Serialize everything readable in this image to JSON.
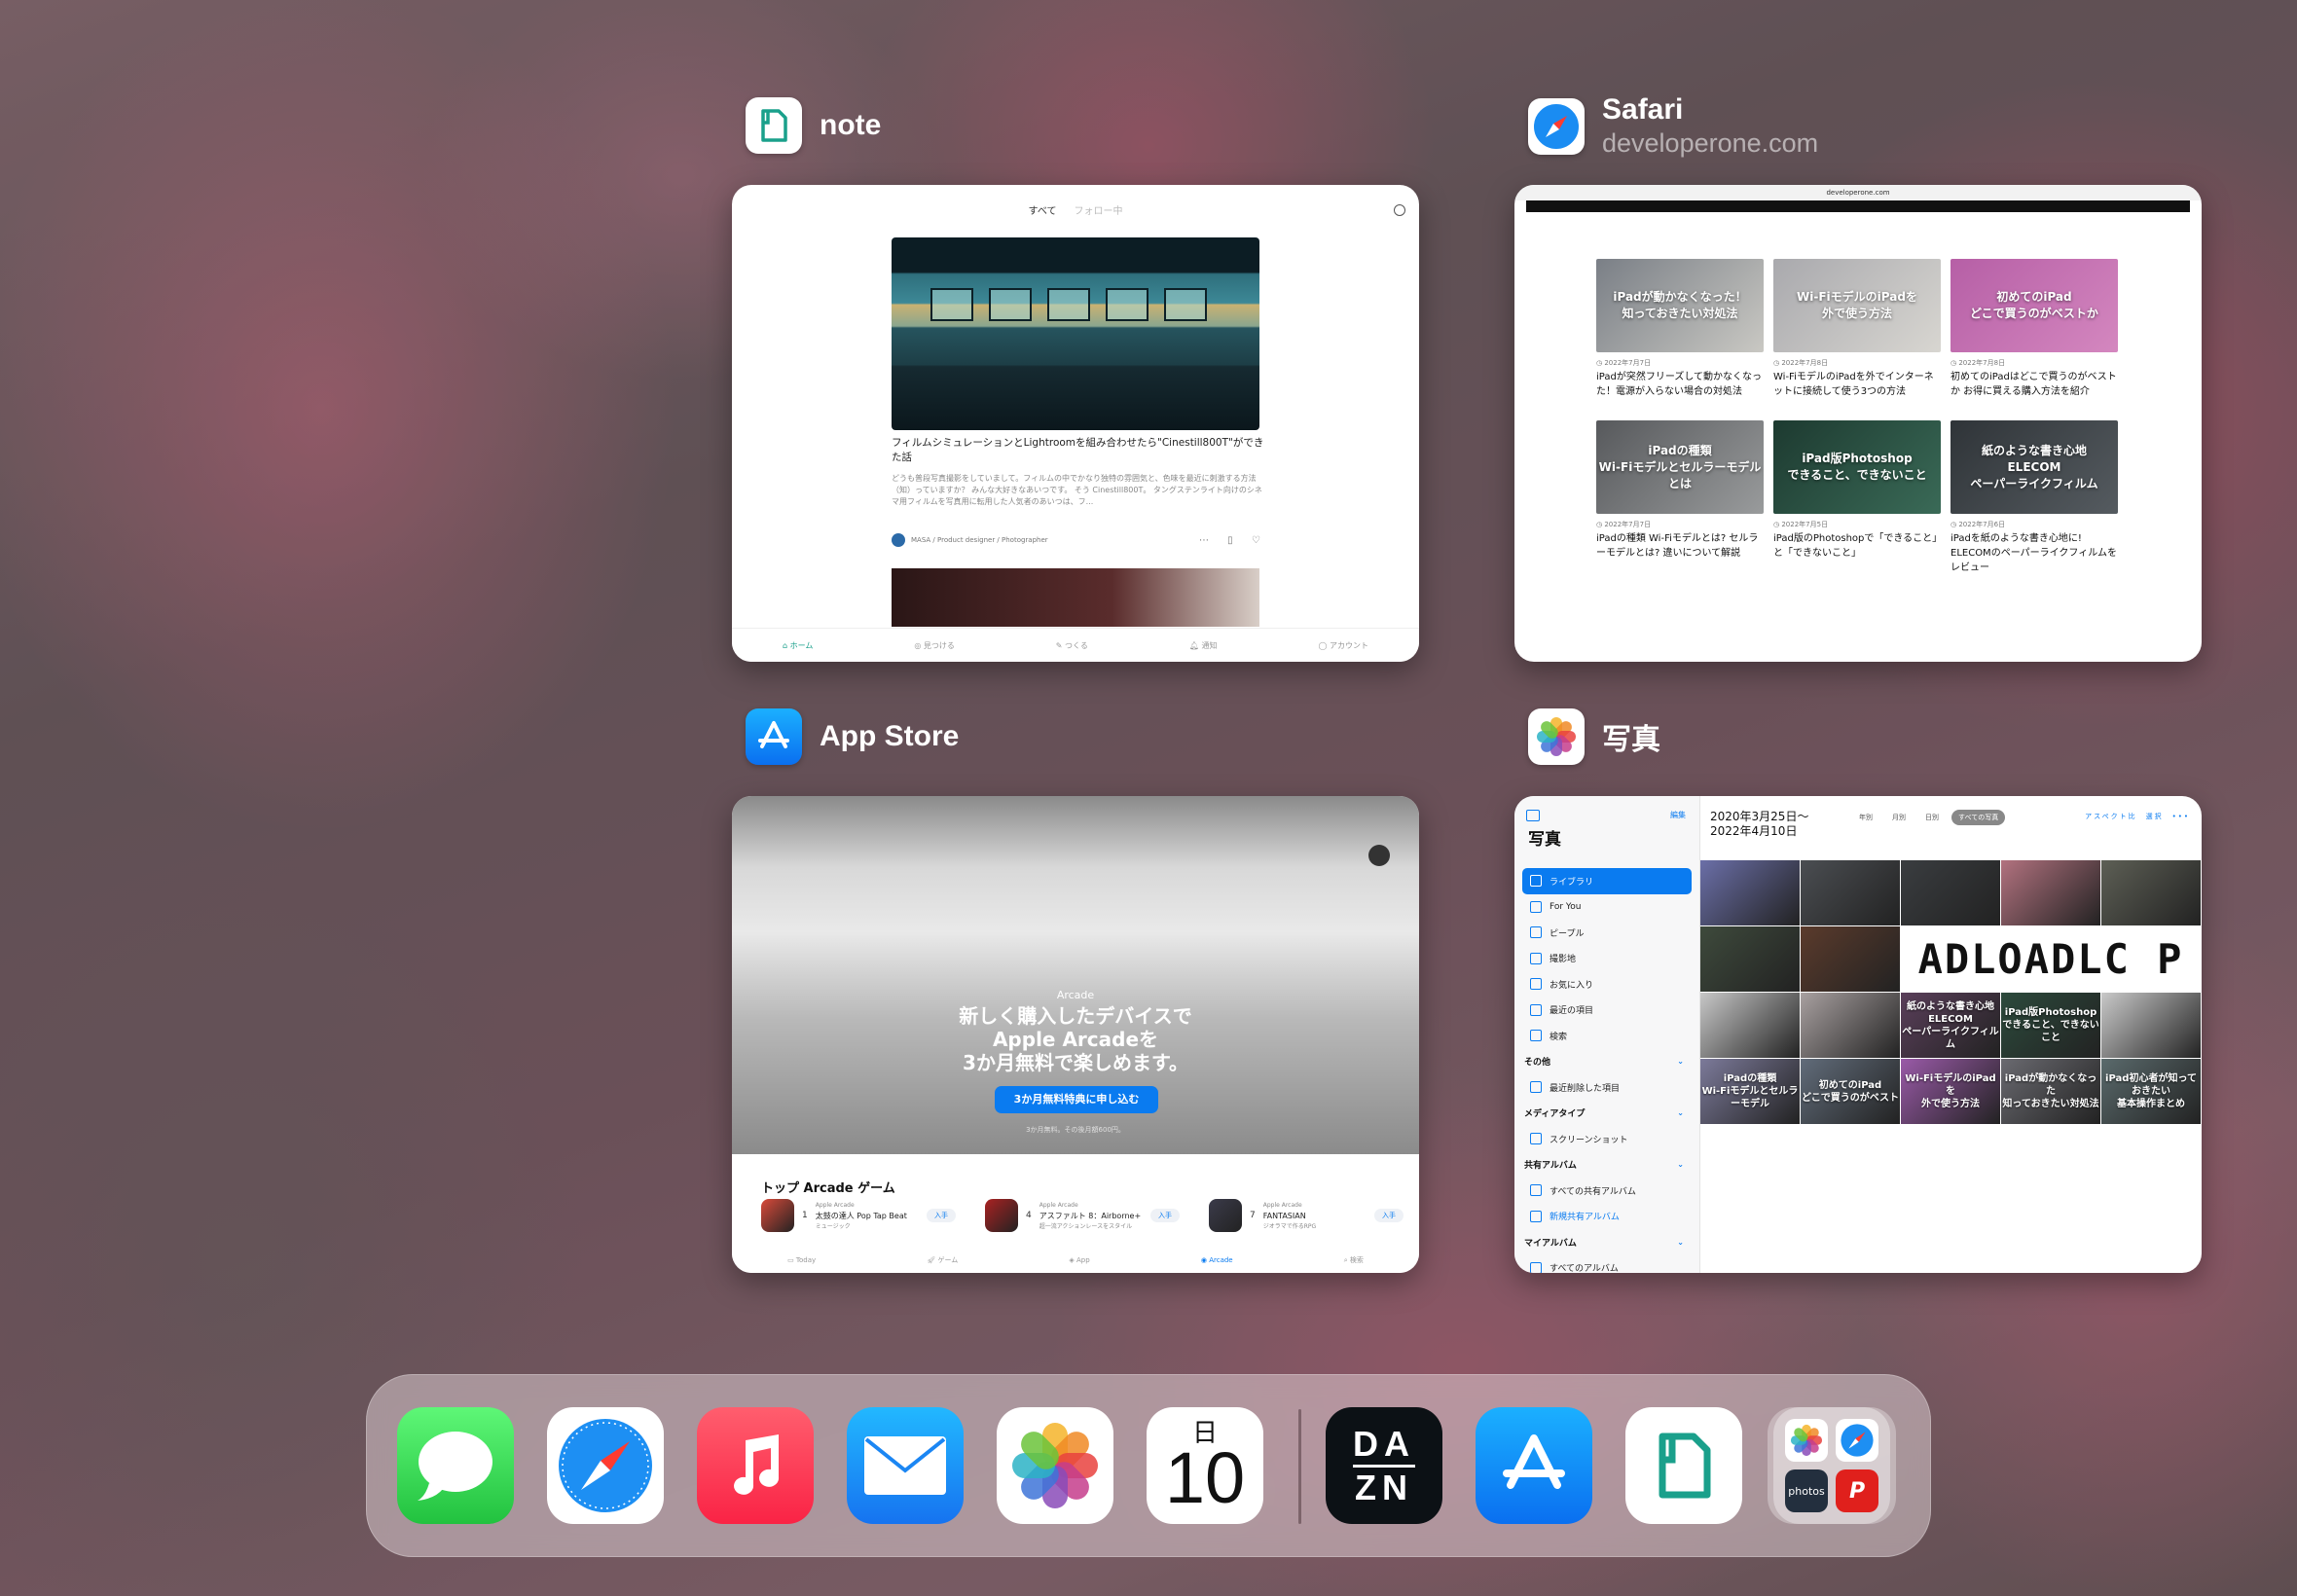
{
  "switcher": {
    "note": {
      "title": "note",
      "top_tabs": [
        "すべて",
        "フォロー中"
      ],
      "caption": "フィルムシミュレーションとLightroomを組み合わせたら\"Cinestill800T\"ができた話",
      "excerpt": "どうも普段写真撮影をしていまして。フィルムの中でかなり独特の雰囲気と、色味を最近に刺激する方法（知）っていますか？ みんな大好きなあいつです。 そう Cinestill800T。 タングステンライト向けのシネマ用フィルムを写真用に転用した人気者のあいつは、フ...",
      "author": "MASA / Product designer / Photographer",
      "tabbar": [
        "ホーム",
        "見つける",
        "つくる",
        "通知",
        "アカウント"
      ]
    },
    "safari": {
      "title": "Safari",
      "subtitle": "developerone.com",
      "url_bar": "developerone.com",
      "articles": [
        {
          "img_text": "iPadが動かなくなった！\n知っておきたい対処法",
          "date": "2022年7月7日",
          "title": "iPadが突然フリーズして動かなくなった！電源が入らない場合の対処法",
          "color1": "#7a7f86",
          "color2": "#c9c8c3"
        },
        {
          "img_text": "Wi-FiモデルのiPadを\n外で使う方法",
          "date": "2022年7月8日",
          "title": "Wi-FiモデルのiPadを外でインターネットに接続して使う3つの方法",
          "color1": "#a9a9ad",
          "color2": "#d8d6d1"
        },
        {
          "img_text": "初めてのiPad\nどこで買うのがベストか",
          "date": "2022年7月8日",
          "title": "初めてのiPadはどこで買うのがベストか お得に買える購入方法を紹介",
          "color1": "#b65fa6",
          "color2": "#d487bf"
        },
        {
          "img_text": "iPadの種類\nWi-Fiモデルとセルラーモデルとは",
          "date": "2022年7月7日",
          "title": "iPadの種類 Wi-Fiモデルとは? セルラーモデルとは? 違いについて解説",
          "color1": "#57595c",
          "color2": "#999b9c"
        },
        {
          "img_text": "iPad版Photoshop\nできること、できないこと",
          "date": "2022年7月5日",
          "title": "iPad版のPhotoshopで「できること」と「できないこと」",
          "color1": "#1d3a30",
          "color2": "#3a6a57"
        },
        {
          "img_text": "紙のような書き心地\nELECOM\nペーパーライクフィルム",
          "date": "2022年7月6日",
          "title": "iPadを紙のような書き心地に! ELECOMのペーパーライクフィルムをレビュー",
          "color1": "#2f3438",
          "color2": "#555b60"
        }
      ]
    },
    "appstore": {
      "title": "App Store",
      "arcade_label": "Arcade",
      "headline": "新しく購入したデバイスで\nApple Arcadeを\n3か月無料で楽しめます。",
      "button": "3か月無料特典に申し込む",
      "fine_print": "3か月無料。その後月額600円。",
      "section": "トップ Arcade ゲーム",
      "games": [
        {
          "rank": "1",
          "source": "Apple Arcade",
          "name": "太鼓の達人 Pop Tap Beat",
          "sub": "ミュージック",
          "get": "入手",
          "color": "#d94a3a"
        },
        {
          "rank": "4",
          "source": "Apple Arcade",
          "name": "アスファルト 8：Airborne+",
          "sub": "超一流アクションレースをスタイル",
          "get": "入手",
          "color": "#aa2222"
        },
        {
          "rank": "7",
          "source": "Apple Arcade",
          "name": "FANTASIAN",
          "sub": "ジオラマで作るRPG",
          "get": "入手",
          "color": "#3b3b4a"
        }
      ],
      "tabbar": [
        "Today",
        "ゲーム",
        "App",
        "Arcade",
        "検索"
      ]
    },
    "photos": {
      "title": "写真",
      "edit": "編集",
      "sidebar_title": "写真",
      "date_range": "2020年3月25日〜\n2022年4月10日",
      "segments": [
        "年別",
        "月別",
        "日別",
        "すべての写真"
      ],
      "tools": "アスペクト比　選択　•••",
      "sidebar": [
        {
          "label": "ライブラリ",
          "type": "item",
          "selected": true
        },
        {
          "label": "For You",
          "type": "item"
        },
        {
          "label": "ピープル",
          "type": "item"
        },
        {
          "label": "撮影地",
          "type": "item"
        },
        {
          "label": "お気に入り",
          "type": "item"
        },
        {
          "label": "最近の項目",
          "type": "item"
        },
        {
          "label": "検索",
          "type": "item"
        },
        {
          "label": "その他",
          "type": "section"
        },
        {
          "label": "最近削除した項目",
          "type": "item"
        },
        {
          "label": "メディアタイプ",
          "type": "section"
        },
        {
          "label": "スクリーンショット",
          "type": "item"
        },
        {
          "label": "共有アルバム",
          "type": "section"
        },
        {
          "label": "すべての共有アルバム",
          "type": "item"
        },
        {
          "label": "新規共有アルバム",
          "type": "item-blue"
        },
        {
          "label": "マイアルバム",
          "type": "section"
        },
        {
          "label": "すべてのアルバム",
          "type": "item"
        }
      ],
      "logo_text": "ADLOADLC P",
      "tile_texts": [
        {
          "index": 10,
          "text": "紙のような書き心地\nELECOM\nペーパーライクフィルム"
        },
        {
          "index": 11,
          "text": "iPad版Photoshop\nできること、できないこと"
        },
        {
          "index": 13,
          "text": "iPadの種類\nWi-Fiモデルとセルラーモデル"
        },
        {
          "index": 14,
          "text": "初めてのiPad\nどこで買うのがベスト"
        },
        {
          "index": 15,
          "text": "Wi-FiモデルのiPadを\n外で使う方法"
        },
        {
          "index": 16,
          "text": "iPadが動かなくなった\n知っておきたい対処法"
        },
        {
          "index": 17,
          "text": "iPad初心者が知っておきたい\n基本操作まとめ"
        }
      ]
    }
  },
  "dock": {
    "apps": [
      "Messages",
      "Safari",
      "Music",
      "Mail",
      "Photos",
      "Calendar",
      "DAZN",
      "App Store",
      "note",
      "Recent apps folder"
    ],
    "calendar_day": "日",
    "calendar_date": "10",
    "dazn_text": [
      "DA",
      "ZN"
    ],
    "folder_labels": [
      "photos",
      "P"
    ]
  },
  "colors": {
    "note_accent": "#1aa08b",
    "ios_blue": "#0a7bf0",
    "messages_green": "#31c759",
    "music_red": "#fa2d48",
    "dazn_dark": "#0c1115"
  }
}
